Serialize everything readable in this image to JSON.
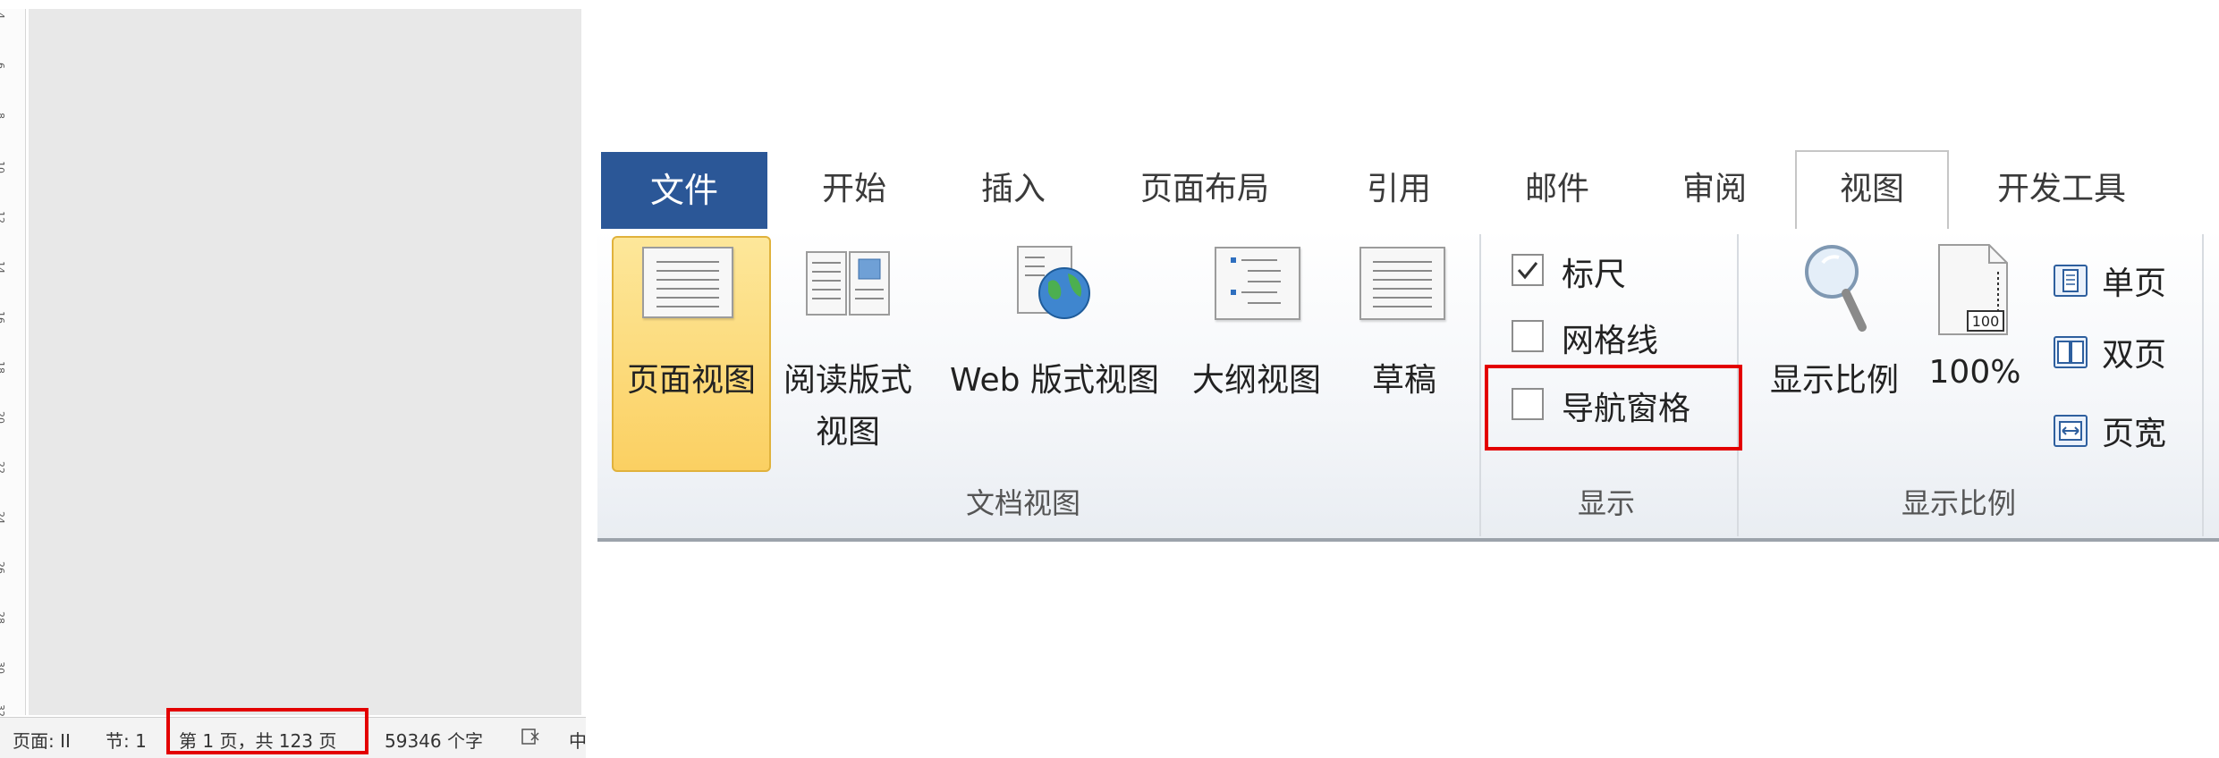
{
  "ruler": {
    "ticks": [
      "4",
      "6",
      "8",
      "10",
      "12",
      "14",
      "16",
      "18",
      "20",
      "22",
      "24",
      "26",
      "28",
      "30",
      "32"
    ]
  },
  "status_bar": {
    "page": "页面: II",
    "section": "节: 1",
    "page_count": "第 1 页，共 123 页",
    "word_count": "59346 个字",
    "language": "中"
  },
  "ribbon": {
    "tabs": [
      "文件",
      "开始",
      "插入",
      "页面布局",
      "引用",
      "邮件",
      "审阅",
      "视图",
      "开发工具"
    ],
    "active_tab": "视图",
    "groups": {
      "document_views": {
        "label": "文档视图",
        "buttons": {
          "page_view": "页面视图",
          "reading_view_line1": "阅读版式",
          "reading_view_line2": "视图",
          "web_view": "Web 版式视图",
          "outline_view": "大纲视图",
          "draft_view": "草稿"
        }
      },
      "show": {
        "label": "显示",
        "ruler": "标尺",
        "ruler_checked": true,
        "gridlines": "网格线",
        "gridlines_checked": false,
        "nav_pane": "导航窗格",
        "nav_pane_checked": false
      },
      "zoom": {
        "label": "显示比例",
        "zoom_button": "显示比例",
        "hundred_percent": "100%",
        "hundred_icon_text": "100",
        "one_page": "单页",
        "two_pages": "双页",
        "page_width": "页宽"
      }
    }
  },
  "colors": {
    "file_tab": "#2b5797",
    "highlight_box": "#e30000",
    "active_button": "#fbd062"
  }
}
